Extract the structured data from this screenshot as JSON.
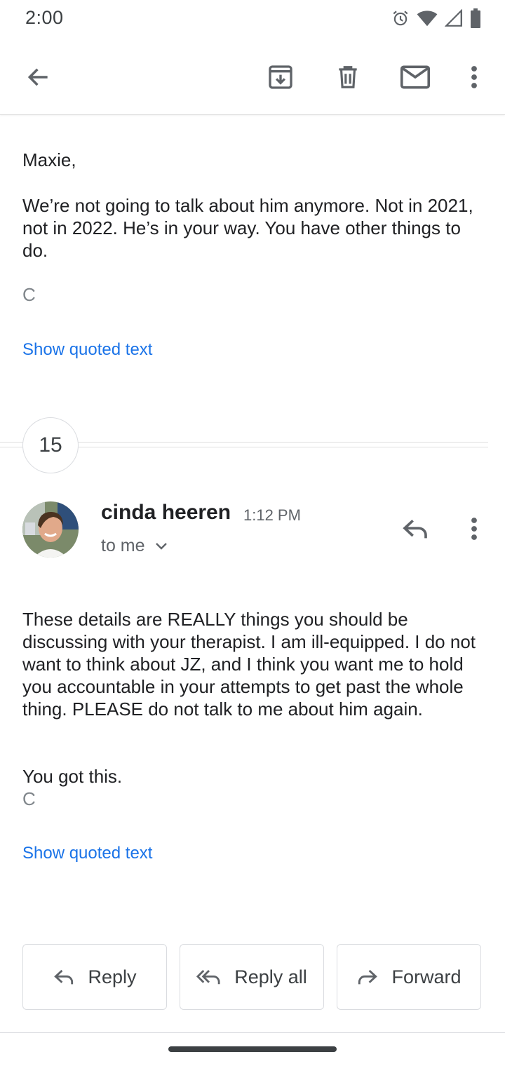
{
  "status_bar": {
    "time": "2:00",
    "icons": [
      "alarm-icon",
      "wifi-icon",
      "signal-icon",
      "battery-icon"
    ]
  },
  "toolbar": {
    "back_icon": "arrow-back-icon",
    "archive_icon": "archive-icon",
    "delete_icon": "delete-icon",
    "mark_unread_icon": "mail-icon",
    "more_icon": "more-vert-icon"
  },
  "previous_message": {
    "greeting": "Maxie,",
    "body": "We’re not going to talk about him anymore. Not in 2021, not in 2022. He’s in your way. You have other things to do.",
    "signature": "C",
    "show_quoted": "Show quoted text"
  },
  "collapsed": {
    "count": "15"
  },
  "message": {
    "sender_name": "cinda heeren",
    "time": "1:12 PM",
    "recipient": "to me",
    "body": "These details are REALLY things you should be discussing with your therapist. I am ill-equipped. I do not want to think about JZ, and I think you want me to hold you accountable in your attempts to get past the whole thing.  PLEASE do not talk to me about him again.",
    "closing": "You got this.",
    "signature": "C",
    "show_quoted": "Show quoted text"
  },
  "actions": {
    "reply": "Reply",
    "reply_all": "Reply all",
    "forward": "Forward"
  },
  "colors": {
    "link": "#1a73e8",
    "text": "#202124",
    "secondary": "#5f6368",
    "border": "#dadce0"
  }
}
